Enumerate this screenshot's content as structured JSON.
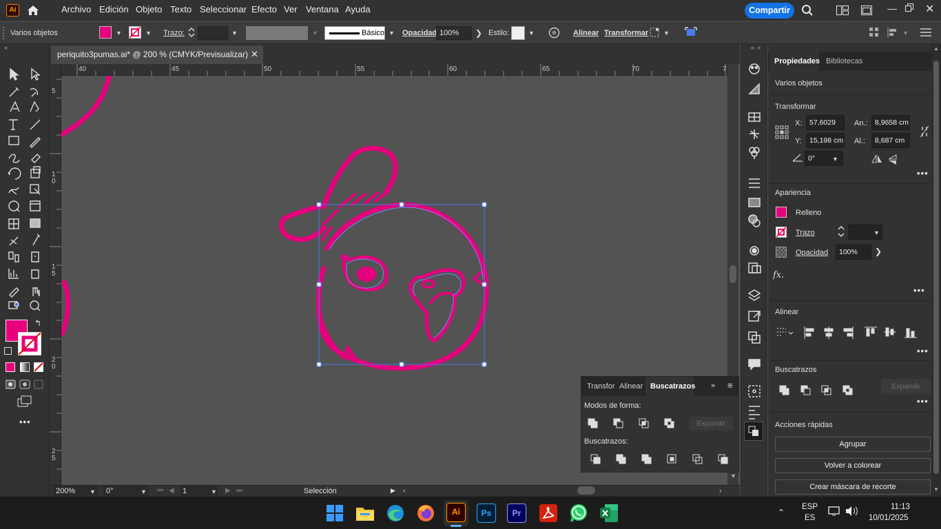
{
  "app": {
    "logo_text": "Ai",
    "menu": [
      "Archivo",
      "Edición",
      "Objeto",
      "Texto",
      "Seleccionar",
      "Efecto",
      "Ver",
      "Ventana",
      "Ayuda"
    ],
    "share_label": "Compartir",
    "accent": "#1473e6"
  },
  "control_bar": {
    "selection_label": "Varios objetos",
    "stroke_label": "Trazo:",
    "brush_label": "Básico",
    "opacity_label": "Opacidad:",
    "opacity_value": "100%",
    "style_label": "Estilo:",
    "align_label": "Alinear",
    "transform_label": "Transformar",
    "fill_color": "#e6007e"
  },
  "document": {
    "tab_title": "periquito3pumas.ai* @ 200 % (CMYK/Previsualizar)",
    "ruler_h": [
      "40",
      "45",
      "50",
      "55",
      "60",
      "65",
      "70",
      "7"
    ],
    "ruler_v": [
      "5",
      "1\n0",
      "1\n5",
      "2\n0",
      "2\n5"
    ],
    "stroke_color": "#e6007e",
    "selection_color": "#4a7bf0"
  },
  "status_bar": {
    "zoom": "200%",
    "angle": "0°",
    "artboard": "1",
    "tool": "Selección"
  },
  "properties": {
    "tabs": [
      "Propiedades",
      "Bibliotecas"
    ],
    "selection": "Varios objetos",
    "transform": {
      "title": "Transformar",
      "x_label": "X:",
      "x_value": "57,6029 cm",
      "y_label": "Y:",
      "y_value": "15,198 cm",
      "w_label": "An.:",
      "w_value": "8,9658 cm",
      "h_label": "Al.:",
      "h_value": "8,687 cm",
      "angle_value": "0°"
    },
    "appearance": {
      "title": "Apariencia",
      "fill_label": "Relleno",
      "stroke_label": "Trazo",
      "opacity_label": "Opacidad",
      "opacity_value": "100%",
      "fx_label": "fx."
    },
    "align_title": "Alinear",
    "pathfinder_title": "Buscatrazos",
    "expand_label": "Expandir",
    "quick_actions": {
      "title": "Acciones rápidas",
      "buttons": [
        "Agrupar",
        "Volver a colorear",
        "Crear máscara de recorte"
      ]
    }
  },
  "pathfinder_panel": {
    "tabs": [
      "Transfor",
      "Alinear",
      "Buscatrazos"
    ],
    "shape_modes_label": "Modos de forma:",
    "expand_label": "Expandir",
    "pathfinders_label": "Buscatrazos:"
  },
  "taskbar": {
    "apps": [
      "windows-start",
      "file-explorer",
      "edge",
      "firefox",
      "illustrator",
      "photoshop",
      "premiere",
      "acrobat",
      "whatsapp",
      "excel"
    ],
    "lang_top": "ESP",
    "lang_bottom": "ES",
    "time": "11:13",
    "date": "10/01/2025"
  }
}
